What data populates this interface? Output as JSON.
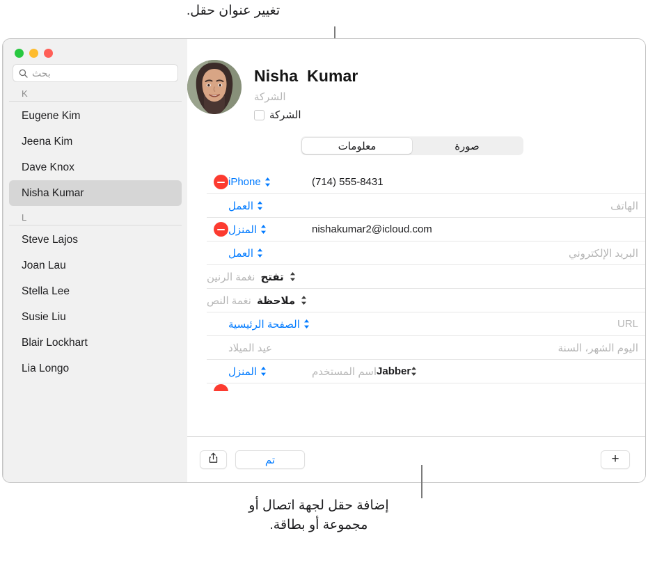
{
  "annotations": {
    "top": "تغيير عنوان حقل.",
    "bottom": "إضافة حقل لجهة اتصال أو\nمجموعة أو بطاقة."
  },
  "colors": {
    "accent_blue": "#007aff",
    "delete_red": "#fc3b30",
    "sidebar_bg": "#f1f1f1",
    "selected_row": "#d6d6d6"
  },
  "window": {
    "traffic_lights": [
      "green",
      "yellow",
      "red"
    ]
  },
  "sidebar": {
    "search": {
      "placeholder": "بحث",
      "value": ""
    },
    "sections": [
      {
        "header": "K",
        "contacts": [
          {
            "name": "Eugene Kim",
            "selected": false
          },
          {
            "name": "Jeena Kim",
            "selected": false
          },
          {
            "name": "Dave Knox",
            "selected": false
          },
          {
            "name": "Nisha Kumar",
            "selected": true
          }
        ]
      },
      {
        "header": "L",
        "contacts": [
          {
            "name": "Steve Lajos",
            "selected": false
          },
          {
            "name": "Joan Lau",
            "selected": false
          },
          {
            "name": "Stella Lee",
            "selected": false
          },
          {
            "name": "Susie Liu",
            "selected": false
          },
          {
            "name": "Blair Lockhart",
            "selected": false
          },
          {
            "name": "Lia Longo",
            "selected": false
          }
        ]
      }
    ]
  },
  "card": {
    "name": "Nisha  Kumar",
    "company_placeholder": "الشركة",
    "company_checkbox_label": "الشركة",
    "tabs": [
      {
        "label": "معلومات",
        "active": true
      },
      {
        "label": "صورة",
        "active": false
      }
    ],
    "fields": [
      {
        "label": "iPhone",
        "label_style": "blue",
        "value": "(714) 555-8431",
        "value_style": "ltr",
        "delete": true
      },
      {
        "label": "العمل",
        "label_style": "blue",
        "value": "الهاتف",
        "value_style": "placeholder",
        "delete": false
      },
      {
        "label": "المنزل",
        "label_style": "blue",
        "value": "nishakumar2@icloud.com",
        "value_style": "ltr",
        "delete": true
      },
      {
        "label": "العمل",
        "label_style": "blue",
        "value": "البريد الإلكتروني",
        "value_style": "placeholder",
        "delete": false
      },
      {
        "label": "تفتح",
        "label_style": "bold",
        "value": "نغمة الرنين",
        "value_style": "placeholder",
        "delete": false
      },
      {
        "label": "ملاحظة",
        "label_style": "bold",
        "value": "نغمة النص",
        "value_style": "placeholder",
        "delete": false
      },
      {
        "label": "الصفحة الرئيسية",
        "label_style": "blue",
        "value": "URL",
        "value_style": "placeholder",
        "delete": false
      },
      {
        "label": "عيد الميلاد",
        "label_style": "dim-nostepper",
        "value": "اليوم الشهر، السنة",
        "value_style": "placeholder",
        "delete": false
      },
      {
        "label": "المنزل",
        "label_style": "blue",
        "value": "اسم المستخدم",
        "value_style": "placeholder",
        "extra": "Jabber",
        "delete": false
      }
    ]
  },
  "toolbar": {
    "share_label": "",
    "done_label": "تم",
    "add_label": "+"
  }
}
